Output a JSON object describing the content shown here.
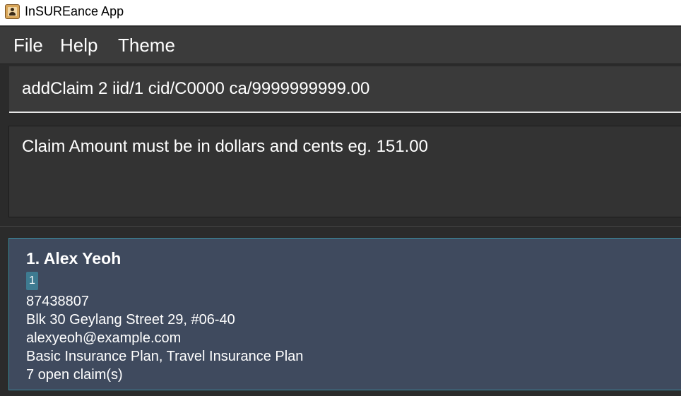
{
  "window": {
    "title": "InSUREance App"
  },
  "menu": {
    "items": [
      "File",
      "Help",
      "Theme"
    ]
  },
  "command": {
    "value": "addClaim 2 iid/1 cid/C0000 ca/9999999999.00"
  },
  "result": {
    "message": "Claim Amount must be in dollars and cents eg. 151.00"
  },
  "persons": [
    {
      "name": "1. Alex Yeoh",
      "tag": "1",
      "phone": "87438807",
      "address": "Blk 30 Geylang Street 29, #06-40",
      "email": "alexyeoh@example.com",
      "policies": "Basic Insurance Plan, Travel Insurance Plan",
      "claims": "7 open claim(s)"
    }
  ],
  "colors": {
    "card_background": "#3f4a5e",
    "card_border": "#3a8c9e",
    "tag_background": "#3e7b91",
    "app_background": "#2b2b2b",
    "menubar_background": "#3b3b3b"
  }
}
